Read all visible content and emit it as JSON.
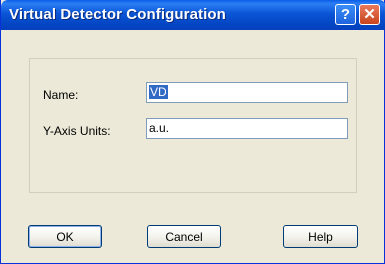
{
  "window": {
    "title": "Virtual Detector Configuration",
    "help_glyph": "?",
    "close_glyph": "✕"
  },
  "form": {
    "name_label": "Name:",
    "name_value": "VD",
    "units_label": "Y-Axis Units:",
    "units_value": "a.u."
  },
  "buttons": {
    "ok": "OK",
    "cancel": "Cancel",
    "help": "Help"
  }
}
